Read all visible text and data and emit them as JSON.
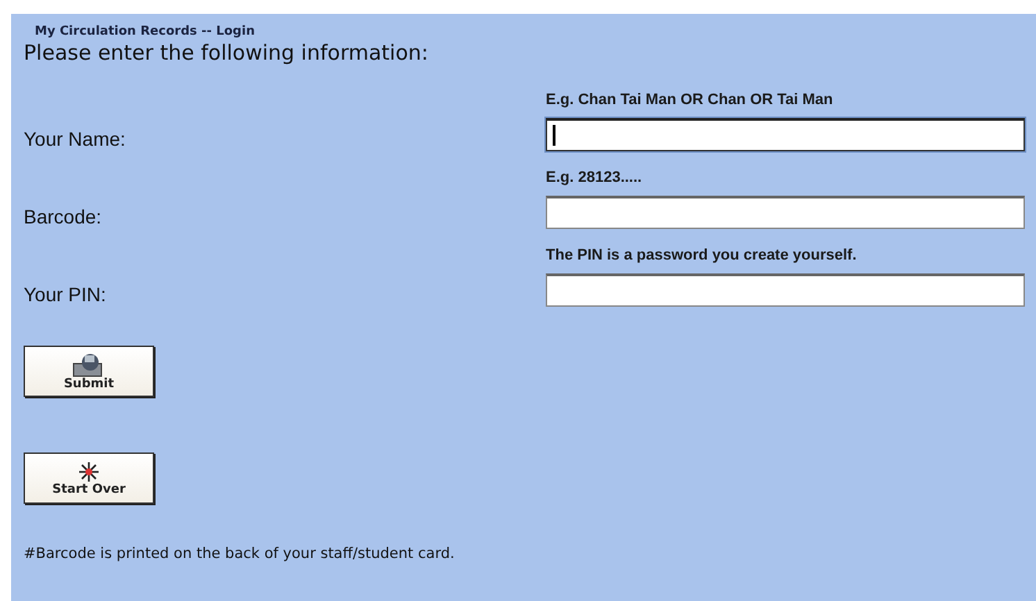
{
  "title": "My Circulation Records -- Login",
  "heading": "Please enter the following information:",
  "fields": [
    {
      "label": "Your Name:",
      "hint": "E.g. Chan Tai Man OR Chan OR Tai Man",
      "focused": true
    },
    {
      "label": "Barcode:",
      "hint": "E.g. 28123.....",
      "focused": false
    },
    {
      "label": "Your PIN:",
      "hint": "The PIN is a password you create yourself.",
      "focused": false
    }
  ],
  "buttons": [
    {
      "kind": "submit",
      "label": "Submit"
    },
    {
      "kind": "reset",
      "label": "Start Over"
    }
  ],
  "footnote": "#Barcode is printed on the back of your staff/student card."
}
